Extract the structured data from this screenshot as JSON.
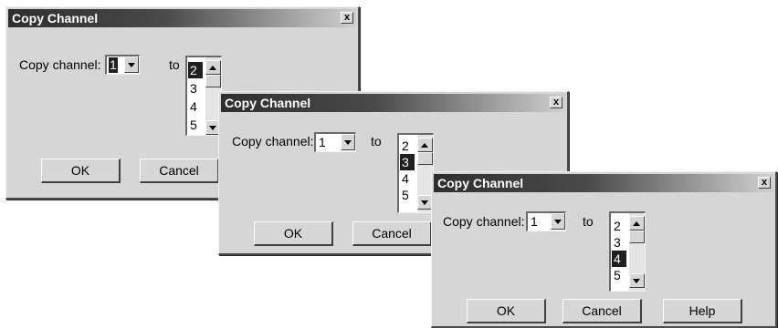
{
  "dialogs": [
    {
      "title": "Copy Channel",
      "close_label": "x",
      "copy_label": "Copy channel:",
      "source_value": "1",
      "to_label": "to",
      "list_items": [
        "2",
        "3",
        "4",
        "5"
      ],
      "selected_item": "2",
      "ok_label": "OK",
      "cancel_label": "Cancel"
    },
    {
      "title": "Copy Channel",
      "close_label": "x",
      "copy_label": "Copy channel:",
      "source_value": "1",
      "to_label": "to",
      "list_items": [
        "2",
        "3",
        "4",
        "5"
      ],
      "selected_item": "3",
      "ok_label": "OK",
      "cancel_label": "Cancel"
    },
    {
      "title": "Copy Channel",
      "close_label": "x",
      "copy_label": "Copy channel:",
      "source_value": "1",
      "to_label": "to",
      "list_items": [
        "2",
        "3",
        "4",
        "5"
      ],
      "selected_item": "4",
      "ok_label": "OK",
      "cancel_label": "Cancel",
      "help_label": "Help"
    }
  ],
  "colors": {
    "dialog_bg": "#d6d6d6",
    "titlebar_dark": "#2e2e2e",
    "selection": "#202020"
  }
}
